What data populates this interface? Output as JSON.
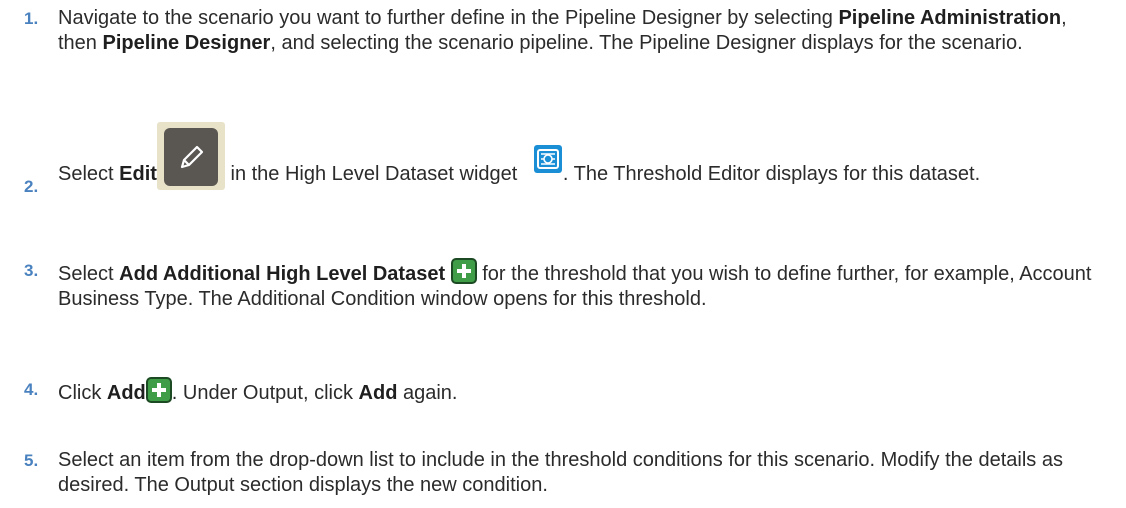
{
  "steps": [
    {
      "number": "1.",
      "t1": "Navigate to the scenario you want to further define in the Pipeline Designer by selecting ",
      "b1": "Pipeline Administration",
      "t2": ", then ",
      "b2": "Pipeline Designer",
      "t3": ", and selecting the scenario pipeline. The Pipeline Designer displays for the scenario."
    },
    {
      "number": "2.",
      "t1": "Select ",
      "b1": "Edit",
      "t2": " in the High Level Dataset widget ",
      "t3": ". The Threshold Editor displays for this dataset."
    },
    {
      "number": "3.",
      "t1": "Select ",
      "b1": "Add Additional High Level Dataset",
      "t2": " for the threshold that you wish to define further, for example, Account Business Type. The Additional Condition window opens for this threshold."
    },
    {
      "number": "4.",
      "t1": "Click ",
      "b1": "Add",
      "t2": ". Under Output, click ",
      "b2": "Add",
      "t3": " again."
    },
    {
      "number": "5.",
      "t1": "Select an item from the drop-down list to include in the threshold conditions for this scenario. Modify the details as desired. The Output section displays the new condition."
    }
  ],
  "icons": {
    "edit": "pencil-edit-icon",
    "widget": "high-level-dataset-widget-icon",
    "add": "green-plus-add-icon"
  },
  "colors": {
    "step_number": "#4a82bf",
    "add_icon": "#3f9d48",
    "widget_icon": "#1a8fd6"
  }
}
